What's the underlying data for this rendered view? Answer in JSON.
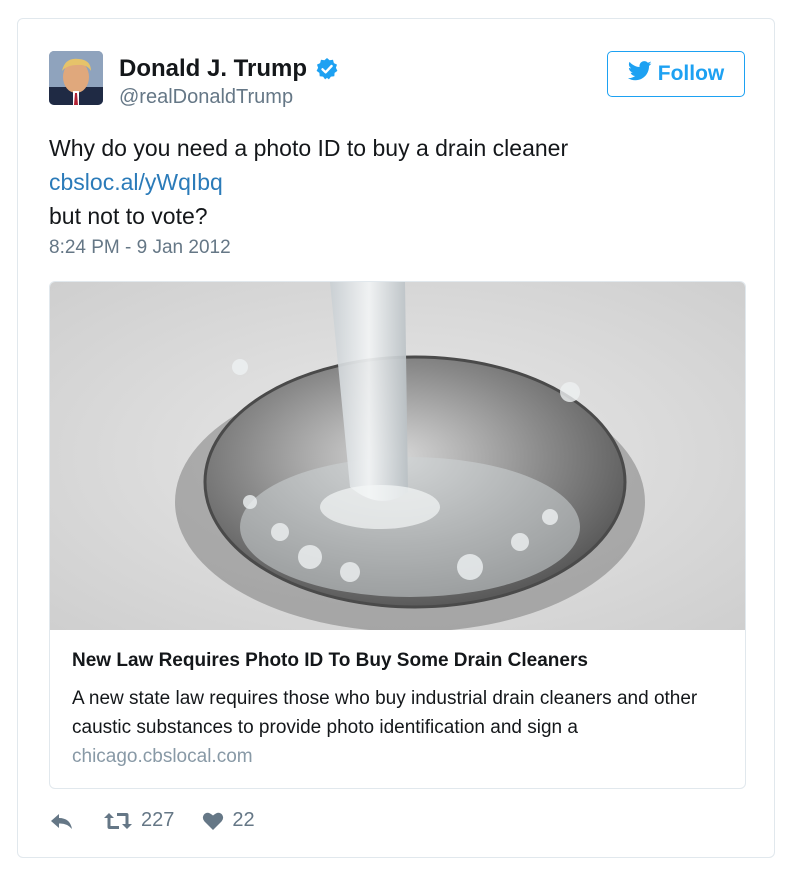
{
  "user": {
    "display_name": "Donald J. Trump",
    "handle": "@realDonaldTrump",
    "verified": true
  },
  "follow_button": {
    "label": "Follow",
    "icon": "twitter-bird-icon"
  },
  "tweet": {
    "text_line_1": "Why do you need a photo ID to buy a drain cleaner",
    "link": "cbsloc.al/yWqIbq",
    "text_line_2": "but not to vote?",
    "timestamp": "8:24 PM - 9 Jan 2012"
  },
  "card": {
    "image_subject": "water-flowing-into-drain",
    "title": "New Law Requires Photo ID To Buy Some Drain Cleaners",
    "description": "A new state law requires those who buy industrial drain cleaners and other caustic substances to provide photo identification and sign a",
    "domain": "chicago.cbslocal.com"
  },
  "actions": {
    "reply_icon": "reply-icon",
    "retweet_icon": "retweet-icon",
    "retweet_count": "227",
    "like_icon": "heart-icon",
    "like_count": "22"
  },
  "colors": {
    "link": "#2b7bb9",
    "brand": "#1da1f2",
    "text": "#14171a",
    "muted": "#657786",
    "border": "#e1e8ed"
  }
}
